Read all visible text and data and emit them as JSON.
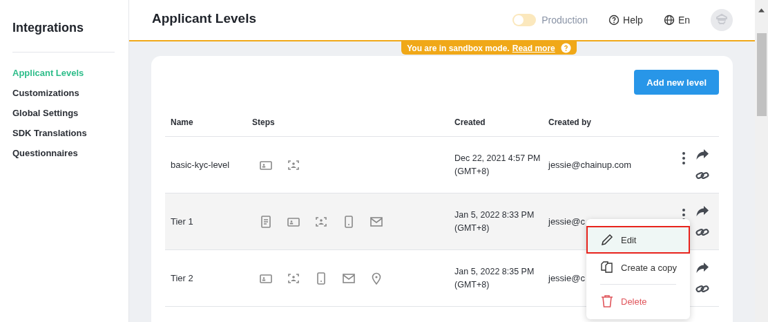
{
  "sidebar": {
    "title": "Integrations",
    "items": [
      {
        "label": "Applicant Levels",
        "selected": true
      },
      {
        "label": "Customizations",
        "selected": false
      },
      {
        "label": "Global Settings",
        "selected": false
      },
      {
        "label": "SDK Translations",
        "selected": false
      },
      {
        "label": "Questionnaires",
        "selected": false
      }
    ]
  },
  "header": {
    "title": "Applicant Levels",
    "production": {
      "label": "Production",
      "on": false
    },
    "help": "Help",
    "language": "En"
  },
  "banner": {
    "text": "You are in sandbox mode.",
    "link": "Read more"
  },
  "add_button": "Add new level",
  "table": {
    "columns": [
      "Name",
      "Steps",
      "Created",
      "Created by"
    ],
    "rows": [
      {
        "name": "basic-kyc-level",
        "steps": [
          {
            "kind": "id-card"
          },
          {
            "kind": "face"
          }
        ],
        "created": "Dec 22, 2021 4:57 PM (GMT+8)",
        "created_by": "jessie@chainup.com"
      },
      {
        "name": "Tier 1",
        "steps": [
          {
            "kind": "document"
          },
          {
            "kind": "id-card"
          },
          {
            "kind": "face"
          },
          {
            "kind": "phone"
          },
          {
            "kind": "email"
          }
        ],
        "created": "Jan 5, 2022 8:33 PM (GMT+8)",
        "created_by": "jessie@c",
        "menu": [
          {
            "kind": "edit",
            "label": "Edit",
            "selected": true
          },
          {
            "kind": "copy",
            "label": "Create a copy",
            "selected": false
          },
          {
            "kind": "delete",
            "label": "Delete",
            "selected": false
          }
        ]
      },
      {
        "name": "Tier 2",
        "steps": [
          {
            "kind": "id-card"
          },
          {
            "kind": "face"
          },
          {
            "kind": "phone"
          },
          {
            "kind": "email"
          },
          {
            "kind": "location"
          }
        ],
        "created": "Jan 5, 2022 8:35 PM (GMT+8)",
        "created_by": "jessie@c"
      }
    ]
  }
}
